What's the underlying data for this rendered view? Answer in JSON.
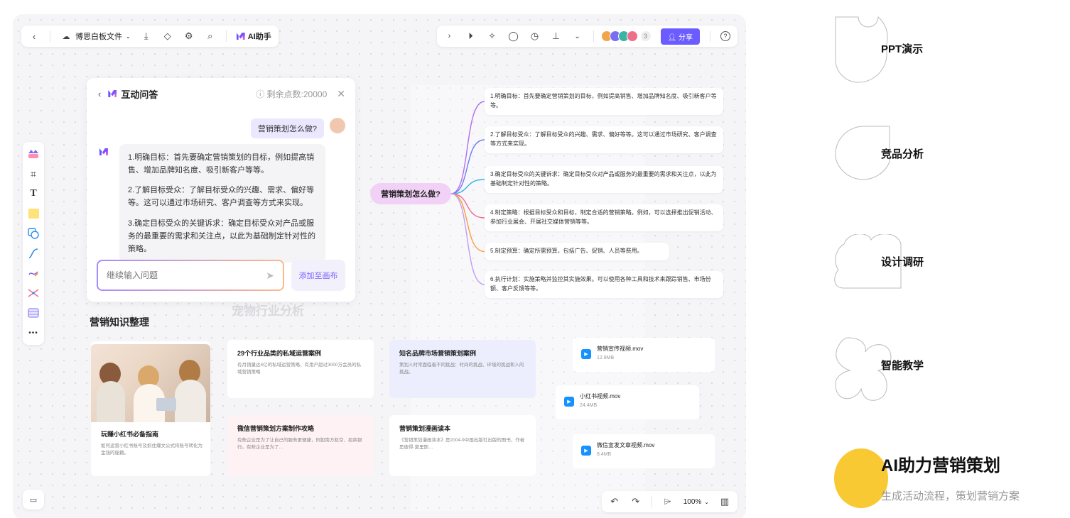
{
  "toolbar": {
    "file_name": "博思白板文件",
    "ai_label": "AI助手",
    "share_label": "分享",
    "collab_count": "3",
    "zoom": "100%"
  },
  "chat": {
    "title": "互动问答",
    "points": "剩余点数:20000",
    "question": "营销策划怎么做?",
    "answers": [
      "1.明确目标：首先要确定营销策划的目标，例如提高销售、增加品牌知名度、吸引新客户等等。",
      "2.了解目标受众：了解目标受众的兴趣、需求、偏好等等。这可以通过市场研究、客户调查等方式来实现。",
      "3.确定目标受众的关键诉求：确定目标受众对产品或服务的最重要的需求和关注点，以此为基础制定针对性的策略。"
    ],
    "input_placeholder": "继续输入问题",
    "add_label": "添加至画布"
  },
  "mindmap": {
    "center": "营销策划怎么做?",
    "branches": [
      "1.明确目标：首先要确定营销策划的目标，例如提高销售、增加品牌知名度、吸引新客户等等。",
      "2.了解目标受众：了解目标受众的兴趣、需求、偏好等等。这可以通过市场研究、客户调查等方式来实现。",
      "3.确定目标受众的关键诉求：确定目标受众对产品或服务的最重要的需求和关注点，以此为基础制定针对性的策略。",
      "4.制定策略：根据目标受众和目标，制定合适的营销策略。例如，可以选择推出促销活动、参加行业展会、开展社交媒体营销等等。",
      "5.制定预算：确定所需预算，包括广告、促销、人员等费用。",
      "6.执行计划：实施策略并监控其实施效果。可以使用各种工具和技术来跟踪销售、市场份额、客户反馈等等。"
    ],
    "branch_colors": [
      "#b36cf0",
      "#6a7cf5",
      "#38b3e6",
      "#f06a8f",
      "#f5a13b",
      "#c59bf5"
    ]
  },
  "background_text": {
    "pet": "宠物行业分析"
  },
  "knowledge": {
    "title": "营销知识整理",
    "cards": [
      {
        "title": "玩赚小红书必备指南",
        "desc": "如何运营小红书账号及抓住爆文公式将账号转化为金钱的秘籍。"
      },
      {
        "title": "29个行业品类的私域运营案例",
        "desc": "有月销量达4亿的私域运营策略、有用户超过3000万会员的私域营销策略"
      },
      {
        "title": "微信营销策划方案制作攻略",
        "desc": "有些企业是为了让自己的服务更便捷，例如南方航空、招商银行。有些企业是为了…"
      },
      {
        "title": "知名品牌市场营销策划案例",
        "desc": "策划人时常面临着不同挑战：时间的挑战、环境的挑战和人的挑战。"
      },
      {
        "title": "营销策划漫画读本",
        "desc": "《营销策划漫画读本》是2004-9中国出版社出版的图书，作者是彼得·莫里斯…"
      }
    ],
    "files": [
      {
        "name": "营销宣传视频.mov",
        "size": "12.8MB"
      },
      {
        "name": "小红书视频.mov",
        "size": "24.4MB"
      },
      {
        "name": "微信宣发文章视频.mov",
        "size": "8.4MB"
      }
    ]
  },
  "menu": {
    "items": [
      "PPT演示",
      "竞品分析",
      "设计调研",
      "智能教学"
    ],
    "highlight_title": "AI助力营销策划",
    "highlight_subtitle": "生成活动流程，策划营销方案",
    "accent": "#f8c932"
  }
}
